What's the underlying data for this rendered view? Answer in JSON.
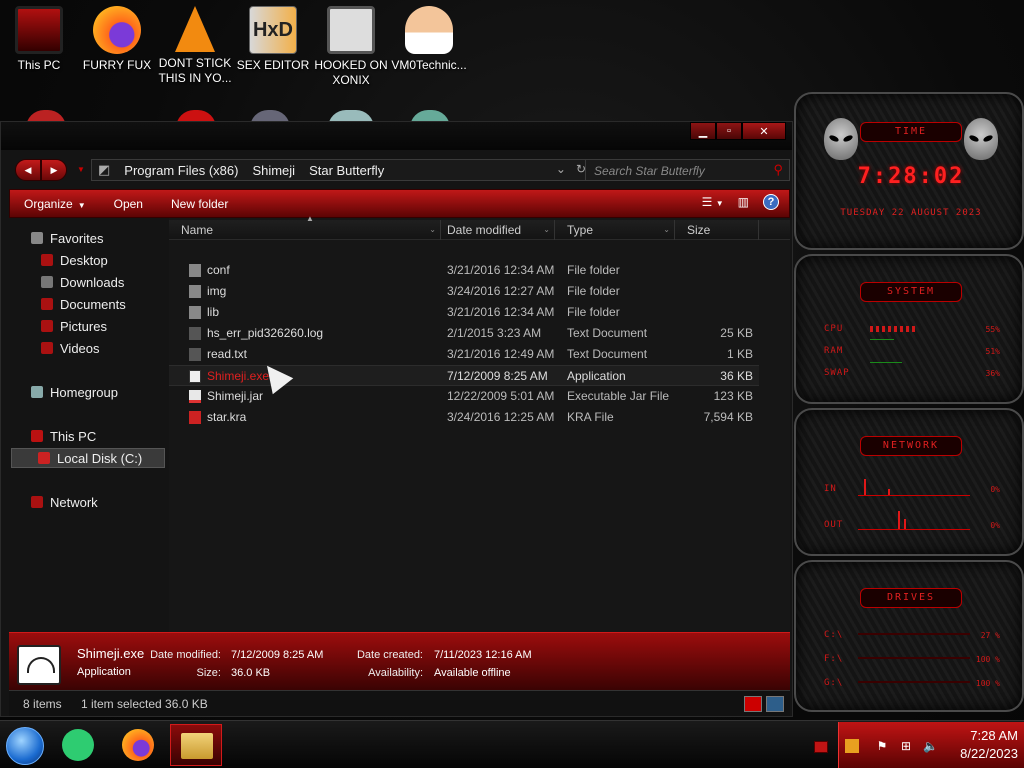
{
  "desktop": {
    "icons": [
      {
        "label": "This PC"
      },
      {
        "label": "FURRY FUX"
      },
      {
        "label": "DONT STICK THIS IN YO..."
      },
      {
        "label": "SEX EDITOR"
      },
      {
        "label": "HOOKED ON XONIX"
      },
      {
        "label": "VM0Technic..."
      }
    ]
  },
  "window": {
    "breadcrumbs": [
      "Program Files (x86)",
      "Shimeji",
      "Star Butterfly"
    ],
    "search_placeholder": "Search Star Butterfly",
    "toolbar": {
      "organize": "Organize",
      "open": "Open",
      "new_folder": "New folder"
    },
    "nav": {
      "favorites": "Favorites",
      "desktop": "Desktop",
      "downloads": "Downloads",
      "documents": "Documents",
      "pictures": "Pictures",
      "videos": "Videos",
      "homegroup": "Homegroup",
      "this_pc": "This PC",
      "local_disk": "Local Disk (C:)",
      "network": "Network"
    },
    "columns": {
      "name": "Name",
      "date": "Date modified",
      "type": "Type",
      "size": "Size"
    },
    "files": [
      {
        "name": "conf",
        "date": "3/21/2016 12:34 AM",
        "type": "File folder",
        "size": ""
      },
      {
        "name": "img",
        "date": "3/24/2016 12:27 AM",
        "type": "File folder",
        "size": ""
      },
      {
        "name": "lib",
        "date": "3/21/2016 12:34 AM",
        "type": "File folder",
        "size": ""
      },
      {
        "name": "hs_err_pid326260.log",
        "date": "2/1/2015 3:23 AM",
        "type": "Text Document",
        "size": "25 KB"
      },
      {
        "name": "read.txt",
        "date": "3/21/2016 12:49 AM",
        "type": "Text Document",
        "size": "1 KB"
      },
      {
        "name": "Shimeji.exe",
        "date": "7/12/2009 8:25 AM",
        "type": "Application",
        "size": "36 KB"
      },
      {
        "name": "Shimeji.jar",
        "date": "12/22/2009 5:01 AM",
        "type": "Executable Jar File",
        "size": "123 KB"
      },
      {
        "name": "star.kra",
        "date": "3/24/2016 12:25 AM",
        "type": "KRA File",
        "size": "7,594 KB"
      }
    ],
    "details": {
      "filename": "Shimeji.exe",
      "kind": "Application",
      "date_modified_label": "Date modified:",
      "date_modified": "7/12/2009 8:25 AM",
      "size_label": "Size:",
      "size": "36.0 KB",
      "date_created_label": "Date created:",
      "date_created": "7/11/2023 12:16 AM",
      "availability_label": "Availability:",
      "availability": "Available offline"
    },
    "status": {
      "items": "8 items",
      "selected": "1 item selected 36.0 KB"
    }
  },
  "gadgets": {
    "time": {
      "title": "TIME",
      "clock": "7:28:02",
      "date": "TUESDAY 22 AUGUST 2023"
    },
    "system": {
      "title": "SYSTEM",
      "cpu_label": "CPU",
      "cpu": "55%",
      "ram_label": "RAM",
      "ram": "51%",
      "swap_label": "SWAP",
      "swap": "36%"
    },
    "network": {
      "title": "NETWORK",
      "in_label": "IN",
      "in": "0%",
      "out_label": "OUT",
      "out": "0%"
    },
    "drives": {
      "title": "DRIVES",
      "c_label": "C:\\",
      "c": "27 %",
      "f_label": "F:\\",
      "f": "100 %",
      "g_label": "G:\\",
      "g": "100 %"
    }
  },
  "taskbar": {
    "time": "7:28 AM",
    "date": "8/22/2023"
  }
}
